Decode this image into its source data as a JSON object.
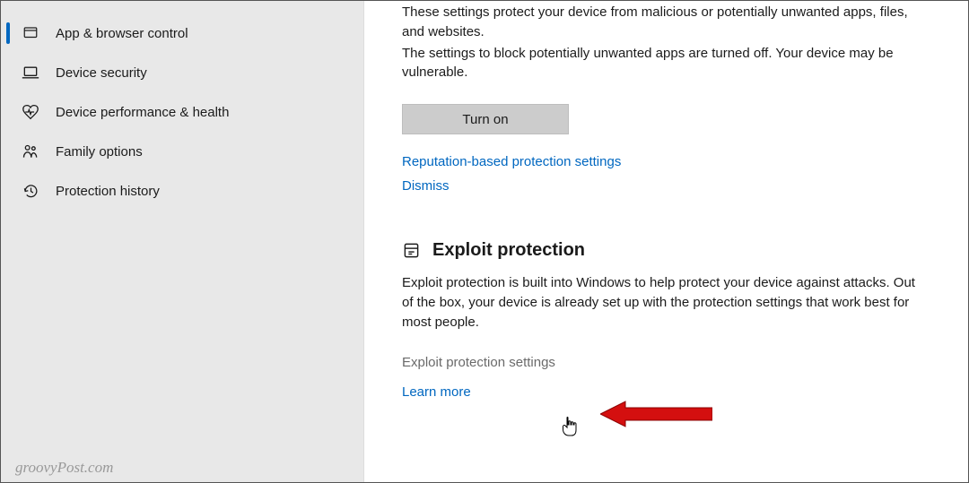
{
  "sidebar": {
    "items": [
      {
        "label": "App & browser control"
      },
      {
        "label": "Device security"
      },
      {
        "label": "Device performance & health"
      },
      {
        "label": "Family options"
      },
      {
        "label": "Protection history"
      }
    ]
  },
  "reputation": {
    "para1": "These settings protect your device from malicious or potentially unwanted apps, files, and websites.",
    "para2": "The settings to block potentially unwanted apps are turned off. Your device may be vulnerable.",
    "turn_on": "Turn on",
    "settings_link": "Reputation-based protection settings",
    "dismiss": "Dismiss"
  },
  "exploit": {
    "title": "Exploit protection",
    "desc": "Exploit protection is built into Windows to help protect your device against attacks.  Out of the box, your device is already set up with the protection settings that work best for most people.",
    "settings_link": "Exploit protection settings",
    "learn_more": "Learn more"
  },
  "watermark": "groovyPost.com"
}
